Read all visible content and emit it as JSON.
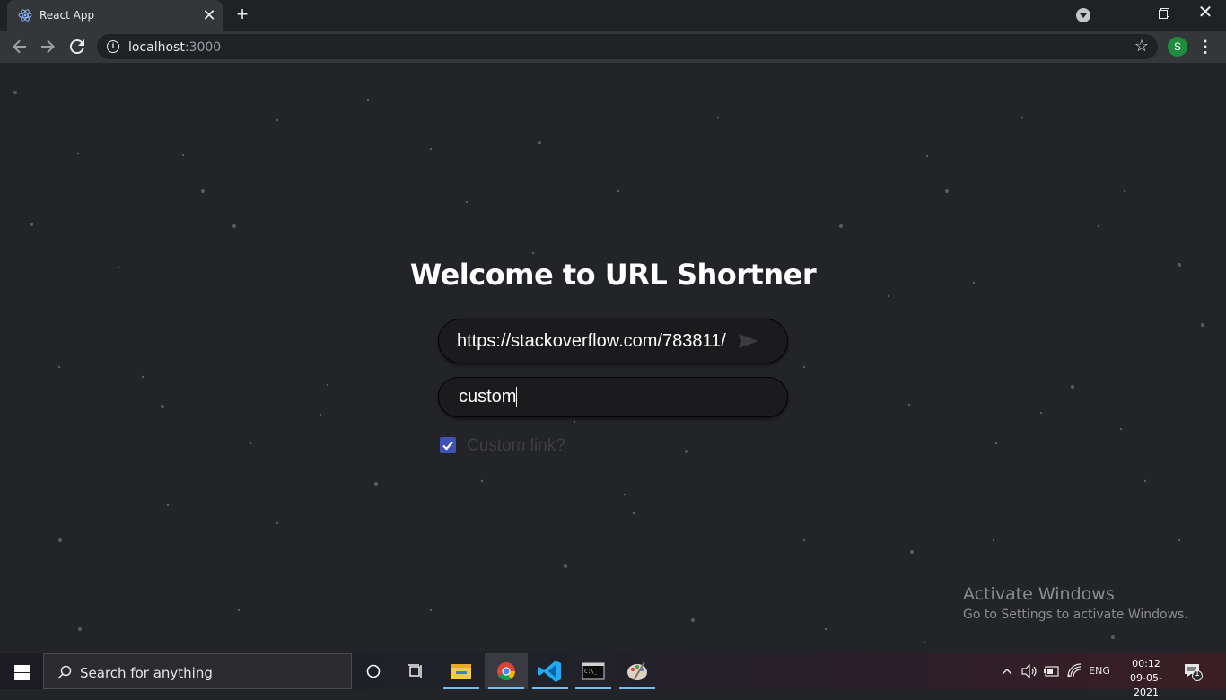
{
  "browser": {
    "tab_title": "React App",
    "tab_close": "✕",
    "new_tab": "+",
    "url_host": "localhost",
    "url_port": ":3000",
    "avatar_letter": "S",
    "star": "☆",
    "menu": "⋮"
  },
  "window_controls": {
    "close": "✕"
  },
  "page": {
    "title": "Welcome to URL Shortner",
    "url_input_value": "https://stackoverflow.com/783811/",
    "custom_input_value": "custom",
    "checkbox_checked": true,
    "checkbox_label": "Custom link?",
    "accent_color": "#3f51b5",
    "background_color": "#232428"
  },
  "watermark": {
    "line1": "Activate Windows",
    "line2": "Go to Settings to activate Windows."
  },
  "taskbar": {
    "search_placeholder": "Search for anything",
    "icons": [
      "cortana-icon",
      "task-view-icon",
      "file-explorer-icon",
      "chrome-icon",
      "vscode-icon",
      "terminal-icon",
      "paint-icon"
    ],
    "language": "ENG",
    "time": "00:12",
    "date": "09-05-2021",
    "notification_count": "1"
  }
}
